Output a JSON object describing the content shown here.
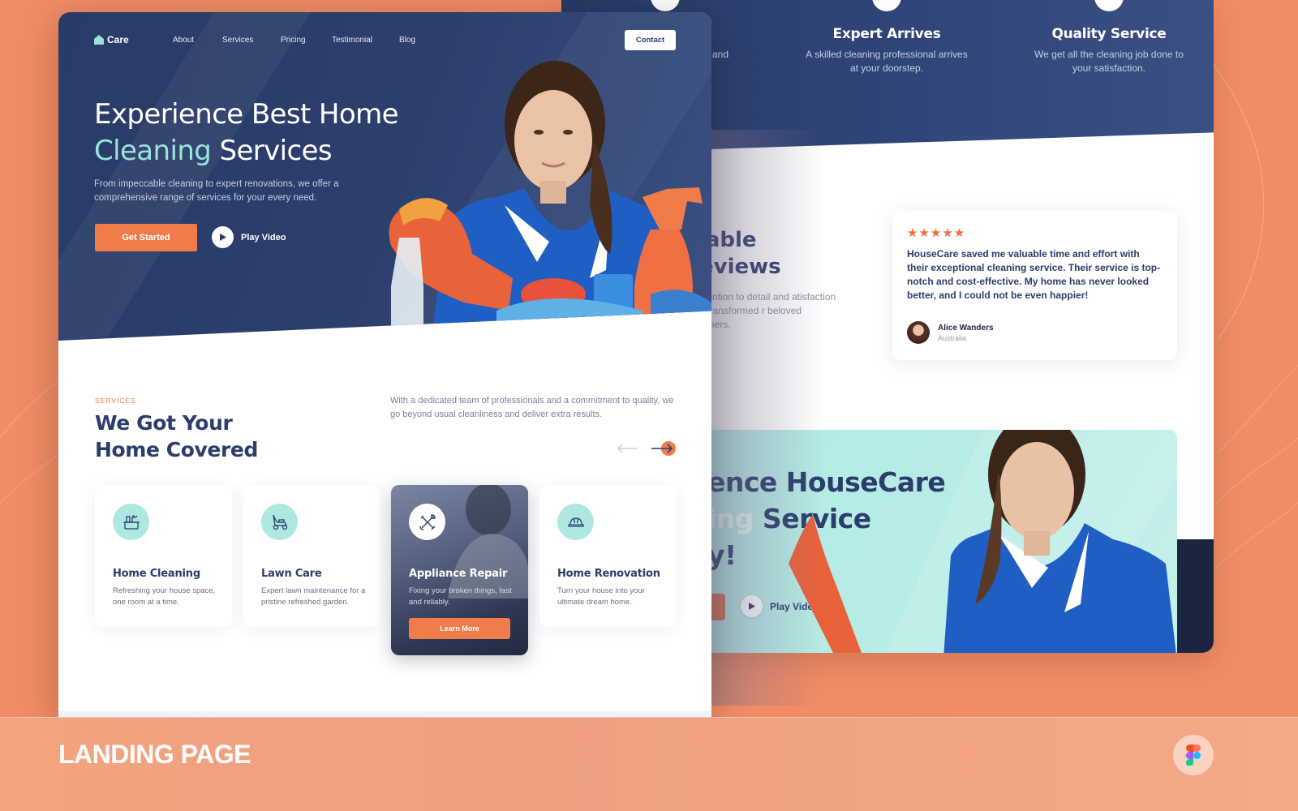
{
  "footer": {
    "title": "LANDING PAGE",
    "tool_icon": "figma-icon"
  },
  "front": {
    "nav": {
      "logo": "Care",
      "links": [
        "About",
        "Services",
        "Pricing",
        "Testimonial",
        "Blog"
      ],
      "contact": "Contact"
    },
    "hero": {
      "title_line1": "Experience Best Home",
      "title_accent": "Cleaning",
      "title_rest": " Services",
      "subtitle": "From impeccable cleaning to expert renovations, we offer a comprehensive range of services for your every need.",
      "cta_primary": "Get Started",
      "cta_secondary": "Play Video"
    },
    "services": {
      "kicker": "SERVICES",
      "title_line1": "We Got Your",
      "title_line2": "Home Covered",
      "description": "With a dedicated team of professionals and a commitment to quality, we go beyond usual cleanliness and deliver extra results.",
      "cards": [
        {
          "title": "Home Cleaning",
          "desc": "Refreshing your house space, one room at a time.",
          "icon": "cleaning-bucket-icon"
        },
        {
          "title": "Lawn Care",
          "desc": "Expert lawn maintenance for a pristine refreshed garden.",
          "icon": "lawn-mower-icon"
        },
        {
          "title": "Appliance Repair",
          "desc": "Fixing your broken things, fast and reliably.",
          "icon": "tools-icon",
          "button": "Learn More"
        },
        {
          "title": "Home Renovation",
          "desc": "Turn your house into your ultimate dream home.",
          "icon": "hard-hat-icon"
        }
      ]
    }
  },
  "back": {
    "steps": [
      {
        "title": "",
        "desc_partial": "and"
      },
      {
        "title": "Expert Arrives",
        "desc": "A skilled cleaning professional arrives at your doorstep."
      },
      {
        "title": "Quality Service",
        "desc": "We get all the cleaning job done to your satisfaction."
      }
    ],
    "reviews": {
      "title_line1": "ctable",
      "title_line2": "Reviews",
      "text": "us attention to detail and atisfaction have transformed r beloved customers.",
      "card": {
        "stars": "★★★★★",
        "rating": 5,
        "quote": "HouseCare saved me valuable time and effort with their exceptional cleaning service. Their service is top-notch and cost-effective. My home has never looked better, and I could not be even happier!",
        "author": "Alice Wanders",
        "location": "Australia"
      }
    },
    "cta": {
      "title_line1": "ence HouseCare",
      "title_accent": "ing",
      "title_line2_rest": " Service",
      "title_line3": "y!",
      "play": "Play Video"
    }
  },
  "colors": {
    "navy": "#2b3d6b",
    "orange": "#f07c4a",
    "mint": "#9be3d9",
    "background": "#f28c65"
  }
}
